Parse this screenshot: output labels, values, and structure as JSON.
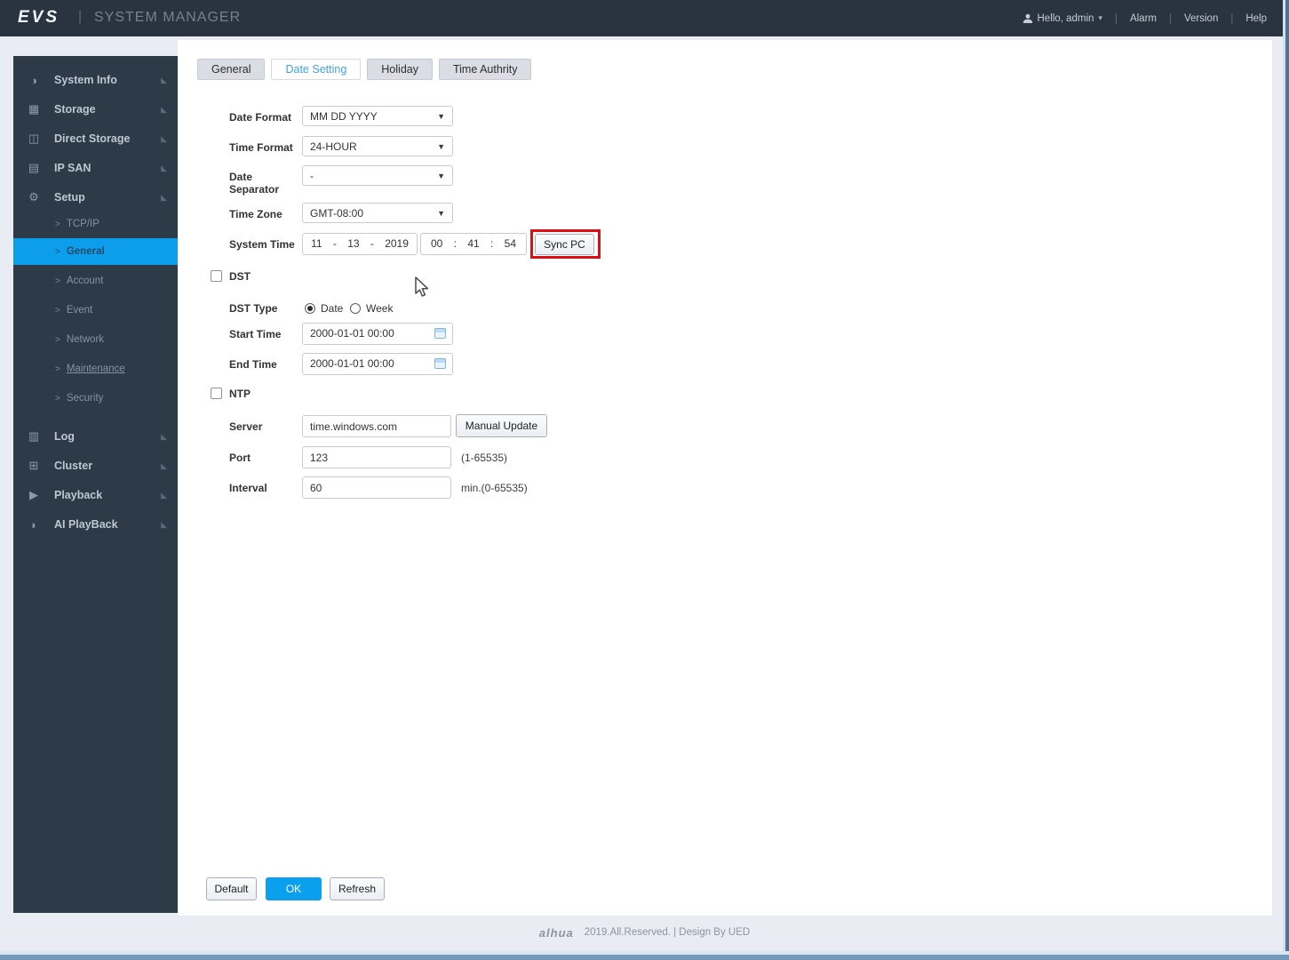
{
  "header": {
    "brand": "EVS",
    "separator": "|",
    "title": "SYSTEM MANAGER",
    "user": "Hello, admin",
    "links": [
      {
        "label": "Alarm"
      },
      {
        "label": "Version"
      },
      {
        "label": "Help"
      }
    ]
  },
  "icons": {
    "chevron": ">",
    "collapse_arrow": "◣",
    "caret_down": "▾",
    "select_caret": "▼",
    "system_info": "◑",
    "storage": "▦",
    "direct_storage": "◫",
    "ip_san": "▤",
    "setup": "⚙",
    "log": "▥",
    "cluster": "⊞",
    "playback": "▶",
    "ai_playback": "◗"
  },
  "sidebar": {
    "items": [
      {
        "label": "System Info"
      },
      {
        "label": "Storage"
      },
      {
        "label": "Direct Storage"
      },
      {
        "label": "IP SAN"
      },
      {
        "label": "Setup",
        "children": [
          {
            "label": "TCP/IP"
          },
          {
            "label": "General",
            "selected": true
          },
          {
            "label": "Account"
          },
          {
            "label": "Event"
          },
          {
            "label": "Network"
          },
          {
            "label": "Maintenance"
          },
          {
            "label": "Security"
          }
        ]
      },
      {
        "label": "Log"
      },
      {
        "label": "Cluster"
      },
      {
        "label": "Playback"
      },
      {
        "label": "AI PlayBack"
      }
    ]
  },
  "tabs": [
    {
      "label": "General"
    },
    {
      "label": "Date Setting",
      "active": true
    },
    {
      "label": "Holiday"
    },
    {
      "label": "Time Authrity"
    }
  ],
  "form": {
    "date_format": {
      "label": "Date Format",
      "value": "MM DD YYYY"
    },
    "time_format": {
      "label": "Time Format",
      "value": "24-HOUR"
    },
    "date_separator": {
      "label": "Date Separator",
      "value": "-"
    },
    "time_zone": {
      "label": "Time Zone",
      "value": "GMT-08:00"
    },
    "system_time": {
      "label": "System Time",
      "date": "11 - 13 - 2019",
      "time": "00 : 41 : 54",
      "sync_button": "Sync PC"
    },
    "dst": {
      "label": "DST",
      "checked": false
    },
    "dst_type": {
      "label": "DST Type",
      "options": [
        "Date",
        "Week"
      ],
      "selected": "Date"
    },
    "start_time": {
      "label": "Start Time",
      "value": "2000-01-01 00:00"
    },
    "end_time": {
      "label": "End Time",
      "value": "2000-01-01 00:00"
    },
    "ntp": {
      "label": "NTP",
      "checked": false
    },
    "server": {
      "label": "Server",
      "value": "time.windows.com",
      "button": "Manual Update"
    },
    "port": {
      "label": "Port",
      "value": "123",
      "hint": "(1-65535)"
    },
    "interval": {
      "label": "Interval",
      "value": "60",
      "hint": "min.(0-65535)"
    }
  },
  "actions": {
    "default": "Default",
    "ok": "OK",
    "refresh": "Refresh"
  },
  "footer": {
    "logo": "alhua",
    "text": "2019.All.Reserved. | Design By UED"
  },
  "colors": {
    "accent_blue": "#0d9eeb",
    "highlight_red": "#df0d10",
    "header_bg": "#293440",
    "sidebar_bg": "#2d3a47"
  }
}
